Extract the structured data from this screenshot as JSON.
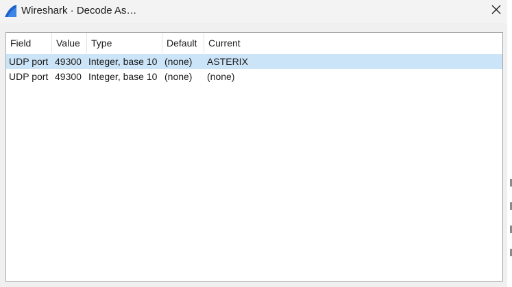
{
  "window": {
    "title": "Wireshark · Decode As…"
  },
  "icons": {
    "app": "wireshark-fin-icon",
    "close": "close-icon"
  },
  "colors": {
    "selection": "#cce4f7",
    "app_icon": "#1f62c9"
  },
  "table": {
    "columns": [
      "Field",
      "Value",
      "Type",
      "Default",
      "Current"
    ],
    "rows": [
      {
        "field": "UDP port",
        "value": "49300",
        "type": "Integer, base 10",
        "default": "(none)",
        "current": "ASTERIX",
        "selected": true
      },
      {
        "field": "UDP port",
        "value": "49300",
        "type": "Integer, base 10",
        "default": "(none)",
        "current": "(none)",
        "selected": false
      }
    ]
  }
}
